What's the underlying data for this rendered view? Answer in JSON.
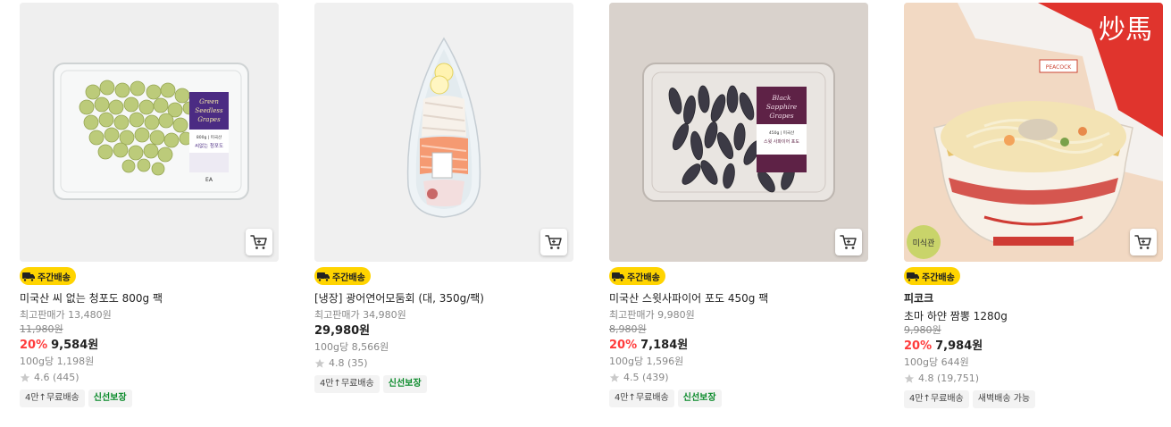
{
  "products": [
    {
      "delivery_badge": "주간배송",
      "title": "미국산 씨 없는 청포도 800g 팩",
      "best_price": "최고판매가 13,480원",
      "original_price": "11,980원",
      "discount": "20%",
      "price": "9,584원",
      "unit_price": "100g당 1,198원",
      "rating": "4.6 (445)",
      "chips": [
        "4만↑무료배송",
        "신선보장"
      ],
      "package_label": [
        "Green",
        "Seedless",
        "Grapes",
        "800g | 미국산",
        "씨없는 청포도",
        "EA"
      ]
    },
    {
      "delivery_badge": "주간배송",
      "title": "[냉장] 광어연어모둠회 (대, 350g/팩)",
      "price": "29,980원",
      "best_price": "최고판매가 34,980원",
      "unit_price": "100g당 8,566원",
      "rating": "4.8 (35)",
      "chips": [
        "4만↑무료배송",
        "신선보장"
      ]
    },
    {
      "delivery_badge": "주간배송",
      "title": "미국산 스윗사파이어 포도 450g 팩",
      "best_price": "최고판매가 9,980원",
      "original_price": "8,980원",
      "discount": "20%",
      "price": "7,184원",
      "unit_price": "100g당 1,596원",
      "rating": "4.5 (439)",
      "chips": [
        "4만↑무료배송",
        "신선보장"
      ],
      "package_label": [
        "Black",
        "Sapphire",
        "Grapes",
        "450g | 미국산",
        "스윗 사파이어 포도"
      ]
    },
    {
      "delivery_badge": "주간배송",
      "brand": "피코크",
      "title": "초마 하얀 짬뽕 1280g",
      "original_price": "9,980원",
      "discount": "20%",
      "price": "7,984원",
      "unit_price": "100g당 644원",
      "rating": "4.8 (19,751)",
      "chips": [
        "4만↑무료배송",
        "새벽배송 가능"
      ],
      "image_badge": "미식관",
      "package_label": [
        "PEACOCK",
        "炒馬"
      ]
    }
  ],
  "colors": {
    "discount": "#ff3b3b",
    "badge": "#ffd400",
    "fresh": "#0a8a2a"
  },
  "icons": {
    "cart": "cart-icon",
    "star": "star-icon",
    "truck": "truck-icon"
  }
}
